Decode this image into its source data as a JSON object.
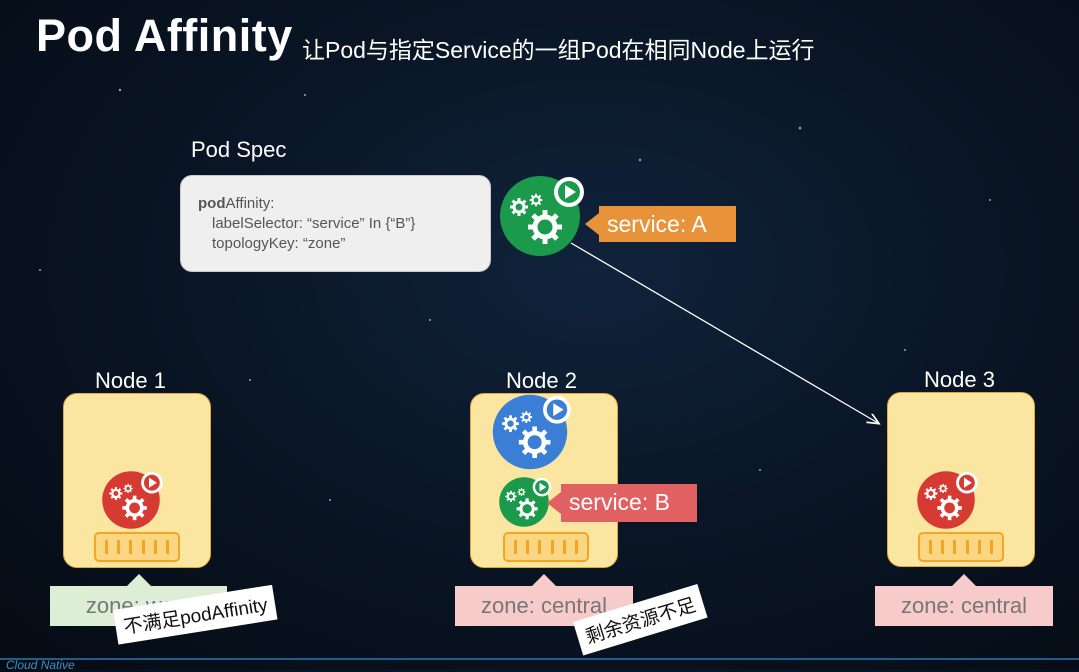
{
  "header": {
    "title": "Pod Affinity",
    "subtitle": "让Pod与指定Service的一组Pod在相同Node上运行"
  },
  "pod_spec": {
    "label": "Pod Spec",
    "line1_bold": "pod",
    "line1_rest": "Affinity:",
    "line2": "labelSelector: “service” In {“B”}",
    "line3": "topologyKey: “zone”"
  },
  "service_a": "service: A",
  "service_b": "service: B",
  "nodes": [
    {
      "label": "Node 1",
      "zone": "zone: west",
      "note": "不满足podAffinity"
    },
    {
      "label": "Node 2",
      "zone": "zone: central",
      "note": "剩余资源不足"
    },
    {
      "label": "Node 3",
      "zone": "zone: central"
    }
  ],
  "footer_text": "Cloud Native",
  "colors": {
    "green_pod": "#1a9a4a",
    "blue_pod": "#3a7fd5",
    "red_pod": "#d63b33",
    "service_a": "#e8933a",
    "service_b": "#e16062",
    "node_fill": "#fbe6a1",
    "zone_west": "#dceed5",
    "zone_central": "#f6cbca"
  }
}
